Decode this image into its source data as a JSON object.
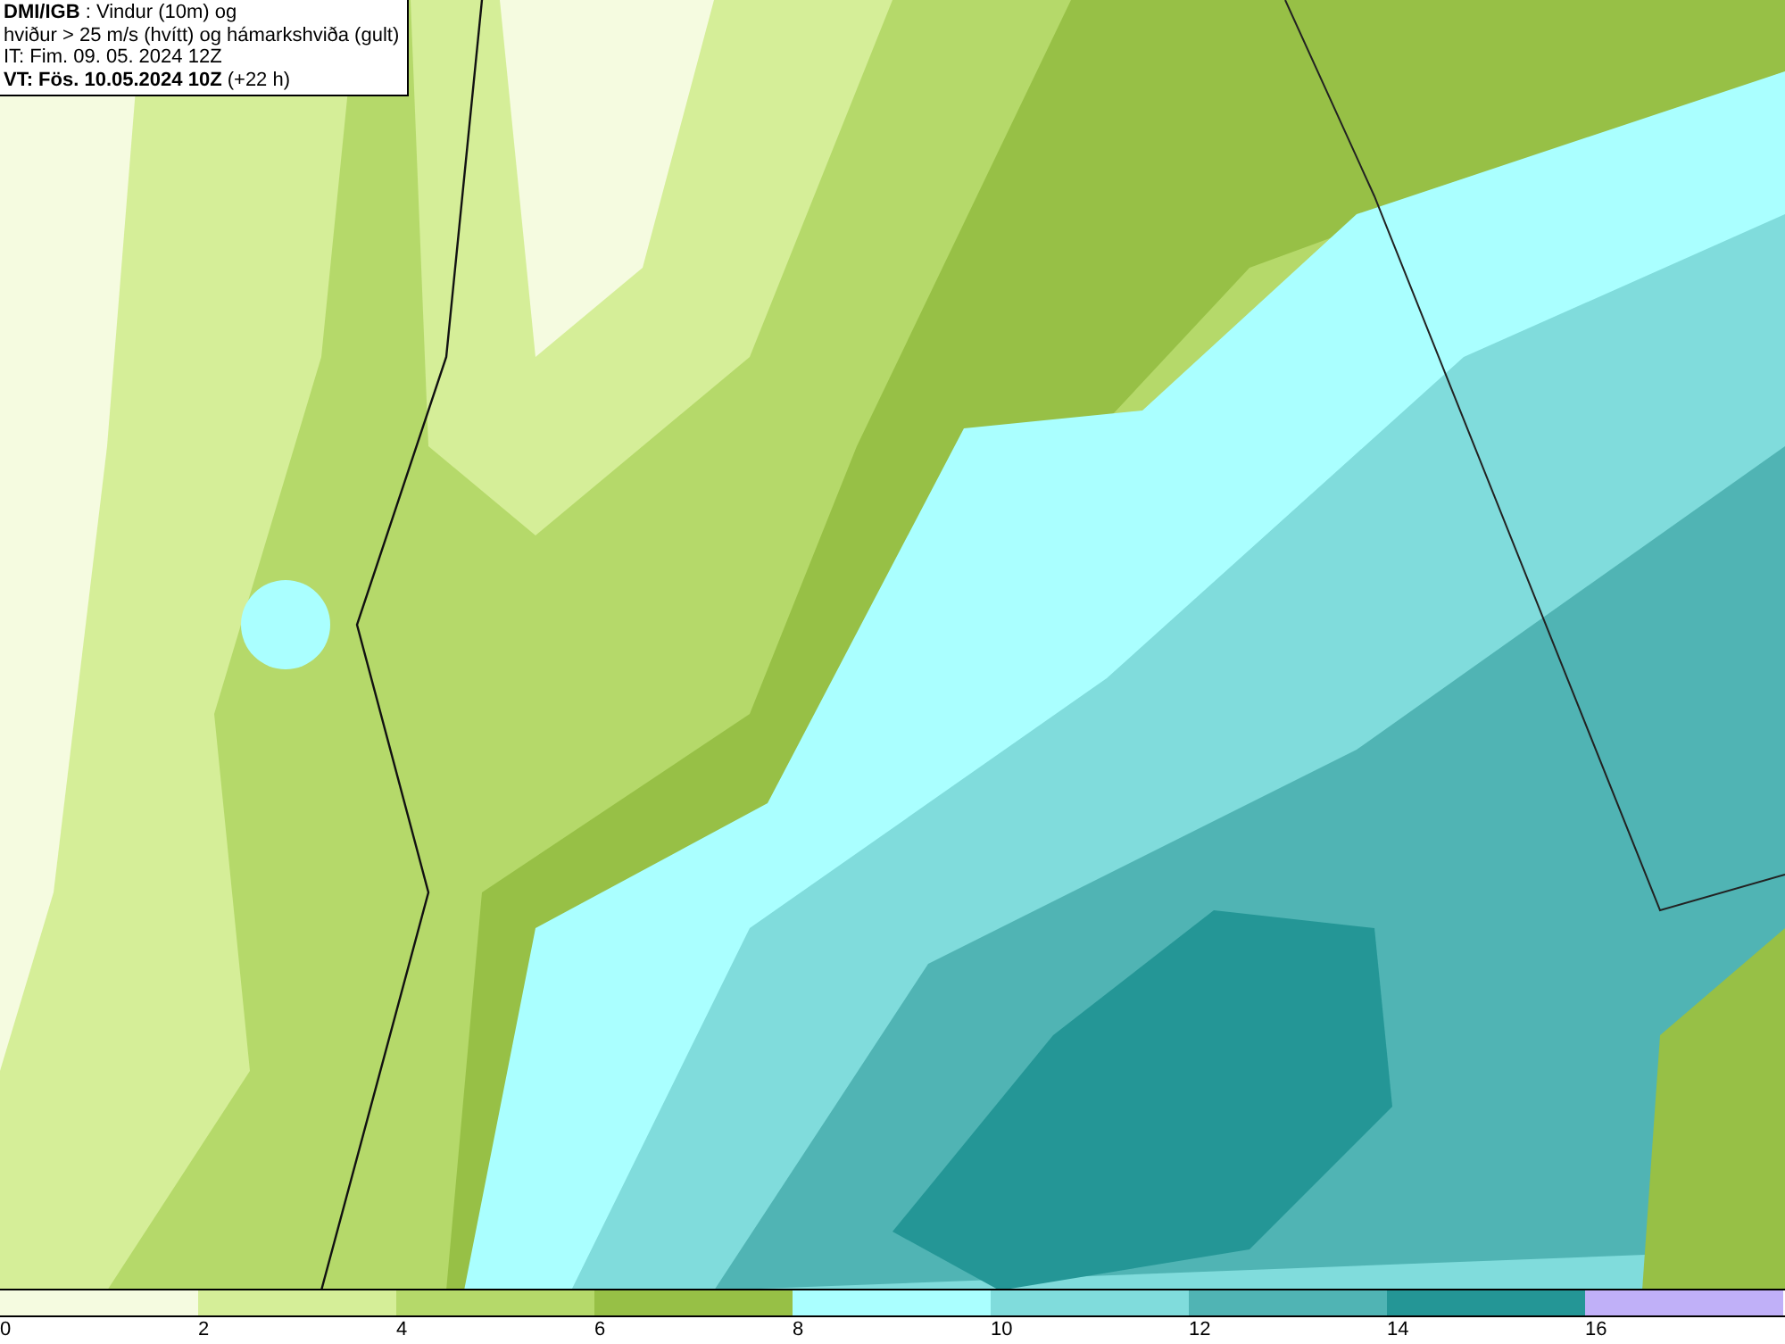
{
  "header": {
    "lines": [
      "**DMI/IGB** : Vindur (10m) og",
      "hviður > 25 m/s (hvítt) og hámarkshviða (gult)",
      "IT: Fim. 09. 05. 2024 12Z",
      "**VT: Fös. 10.05.2024 10Z** (+22 h)"
    ]
  },
  "legend": {
    "segments": [
      {
        "color": "#f5fbe0"
      },
      {
        "color": "#d5ee98"
      },
      {
        "color": "#b5d96a"
      },
      {
        "color": "#97c046"
      },
      {
        "color": "#aaffff"
      },
      {
        "color": "#80dcdc"
      },
      {
        "color": "#50b4b4"
      },
      {
        "color": "#249696"
      },
      {
        "color": "#c0b0f8"
      }
    ],
    "ticks": [
      "0",
      "2",
      "4",
      "6",
      "8",
      "10",
      "12",
      "14",
      "16"
    ]
  }
}
